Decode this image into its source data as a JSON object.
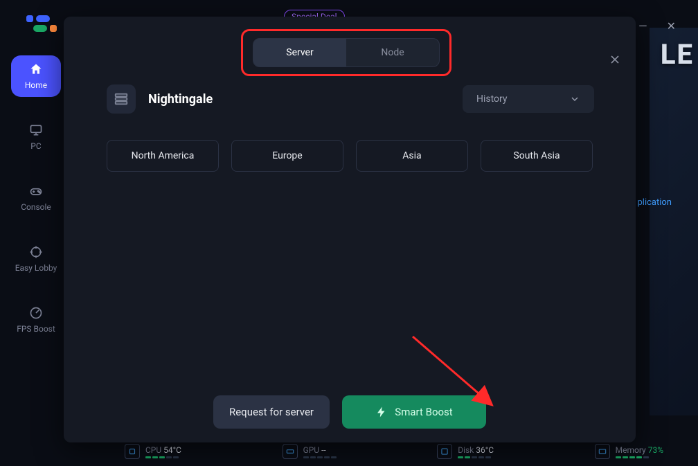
{
  "header": {
    "special_deal": "Special Deal"
  },
  "sidebar": {
    "items": [
      {
        "label": "Home"
      },
      {
        "label": "PC"
      },
      {
        "label": "Console"
      },
      {
        "label": "Easy Lobby"
      },
      {
        "label": "FPS Boost"
      }
    ]
  },
  "modal": {
    "tabs": {
      "server": "Server",
      "node": "Node"
    },
    "game_title": "Nightingale",
    "history_label": "History",
    "regions": [
      "North America",
      "Europe",
      "Asia",
      "South Asia"
    ],
    "request_label": "Request for server",
    "boost_label": "Smart Boost"
  },
  "stats": {
    "cpu_label": "CPU",
    "cpu_val": "54°C",
    "gpu_label": "GPU",
    "gpu_val": "--",
    "disk_label": "Disk",
    "disk_val": "36°C",
    "mem_label": "Memory",
    "mem_val": "73%"
  },
  "bg": {
    "title_fragment": "LE",
    "link_fragment": "plication"
  }
}
